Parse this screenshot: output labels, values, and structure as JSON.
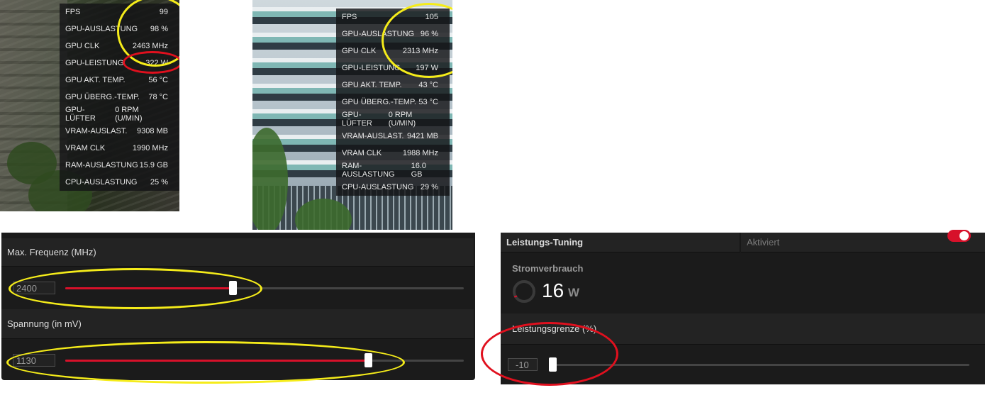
{
  "overlay1": {
    "rows": [
      {
        "label": "FPS",
        "value": "99"
      },
      {
        "label": "GPU-AUSLASTUNG",
        "value": "98 %"
      },
      {
        "label": "GPU CLK",
        "value": "2463 MHz"
      },
      {
        "label": "GPU-LEISTUNG",
        "value": "322 W"
      },
      {
        "label": "GPU AKT. TEMP.",
        "value": "56 °C"
      },
      {
        "label": "GPU ÜBERG.-TEMP.",
        "value": "78 °C"
      },
      {
        "label": "GPU-LÜFTER",
        "value": "0 RPM (U/MIN)"
      },
      {
        "label": "VRAM-AUSLAST.",
        "value": "9308 MB"
      },
      {
        "label": "VRAM CLK",
        "value": "1990 MHz"
      },
      {
        "label": "RAM-AUSLASTUNG",
        "value": "15.9 GB"
      },
      {
        "label": "CPU-AUSLASTUNG",
        "value": "25 %"
      }
    ]
  },
  "overlay2": {
    "rows": [
      {
        "label": "FPS",
        "value": "105"
      },
      {
        "label": "GPU-AUSLASTUNG",
        "value": "96 %"
      },
      {
        "label": "GPU CLK",
        "value": "2313 MHz"
      },
      {
        "label": "GPU-LEISTUNG",
        "value": "197 W"
      },
      {
        "label": "GPU AKT. TEMP.",
        "value": "43 °C"
      },
      {
        "label": "GPU ÜBERG.-TEMP.",
        "value": "53 °C"
      },
      {
        "label": "GPU-LÜFTER",
        "value": "0 RPM (U/MIN)"
      },
      {
        "label": "VRAM-AUSLAST.",
        "value": "9421 MB"
      },
      {
        "label": "VRAM CLK",
        "value": "1988 MHz"
      },
      {
        "label": "RAM-AUSLASTUNG",
        "value": "16.0 GB"
      },
      {
        "label": "CPU-AUSLASTUNG",
        "value": "29 %"
      }
    ]
  },
  "left_panel": {
    "freq": {
      "label": "Max. Frequenz (MHz)",
      "value": "2400",
      "fraction": 0.42
    },
    "volt": {
      "label": "Spannung (in mV)",
      "value": "1130",
      "fraction": 0.76
    }
  },
  "right_panel": {
    "tuning_label": "Leistungs-Tuning",
    "tuning_state": "Aktiviert",
    "power_label": "Stromverbrauch",
    "power_value": "16",
    "power_unit": "W",
    "limit_label": "Leistungsgrenze (%)",
    "limit_value": "-10",
    "limit_fraction": 0.0
  },
  "colors": {
    "accent": "#d7112a",
    "highlight_yellow": "#f5ec1a",
    "highlight_red": "#e0101e"
  }
}
